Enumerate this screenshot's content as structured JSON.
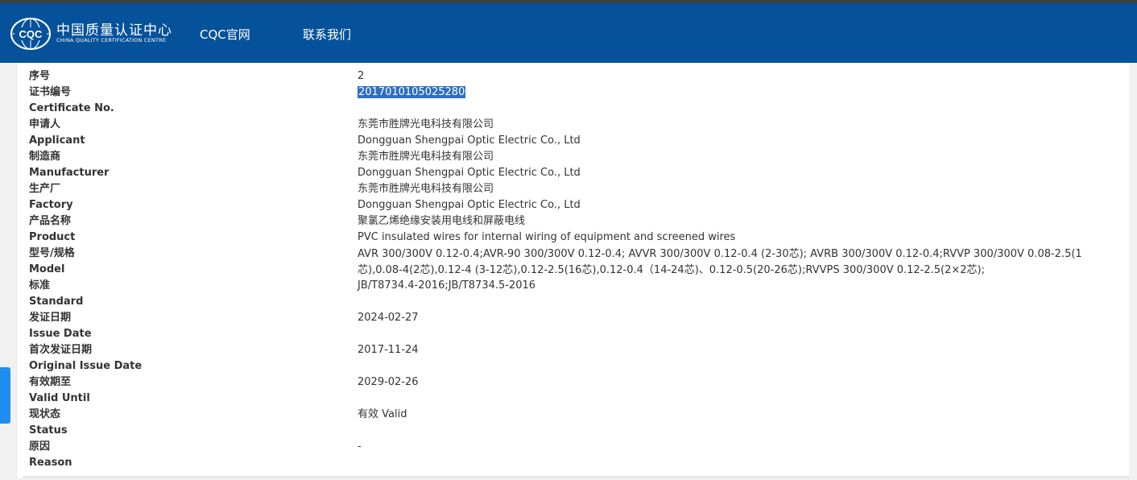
{
  "header": {
    "logo_text_cn": "中国质量认证中心",
    "logo_text_en": "CHINA QUALITY CERTIFICATION CENTRE",
    "logo_mark": "CQC",
    "nav": [
      {
        "label": "CQC官网"
      },
      {
        "label": "联系我们"
      }
    ],
    "bg_color": "#05529a"
  },
  "fields": [
    {
      "label": "序号",
      "value": "2"
    },
    {
      "label": "证书编号",
      "value": "2017010105025280"
    },
    {
      "label": "Certificate No.",
      "value": ""
    },
    {
      "label": "申请人",
      "value": "东莞市胜牌光电科技有限公司"
    },
    {
      "label": "Applicant",
      "value": "Dongguan Shengpai Optic Electric Co., Ltd"
    },
    {
      "label": "制造商",
      "value": "东莞市胜牌光电科技有限公司"
    },
    {
      "label": "Manufacturer",
      "value": "Dongguan Shengpai Optic Electric Co., Ltd"
    },
    {
      "label": "生产厂",
      "value": "东莞市胜牌光电科技有限公司"
    },
    {
      "label": "Factory",
      "value": "Dongguan Shengpai Optic Electric Co., Ltd"
    },
    {
      "label": "产品名称",
      "value": "聚氯乙烯绝缘安装用电线和屏蔽电线"
    },
    {
      "label": "Product",
      "value": "PVC insulated wires for internal wiring of equipment and screened wires"
    },
    {
      "label": "型号/规格",
      "value": "AVR 300/300V 0.12-0.4;AVR-90 300/300V 0.12-0.4; AVVR 300/300V 0.12-0.4 (2-30芯); AVRB 300/300V 0.12-0.4;RVVP 300/300V 0.08-2.5(1芯),0.08-4(2芯),0.12-4 (3-12芯),0.12-2.5(16芯),0.12-0.4（14-24芯)、0.12-0.5(20-26芯);RVVPS 300/300V 0.12-2.5(2×2芯);"
    },
    {
      "label": "Model",
      "value": ""
    },
    {
      "label": "标准",
      "value": "JB/T8734.4-2016;JB/T8734.5-2016"
    },
    {
      "label": "Standard",
      "value": ""
    },
    {
      "label": "发证日期",
      "value": "2024-02-27"
    },
    {
      "label": "Issue Date",
      "value": ""
    },
    {
      "label": "首次发证日期",
      "value": "2017-11-24"
    },
    {
      "label": "Original Issue Date",
      "value": ""
    },
    {
      "label": "有效期至",
      "value": "2029-02-26"
    },
    {
      "label": "Valid Until",
      "value": ""
    },
    {
      "label": "现状态",
      "value": "有效 Valid"
    },
    {
      "label": "Status",
      "value": ""
    },
    {
      "label": "原因",
      "value": "-"
    },
    {
      "label": "Reason",
      "value": ""
    }
  ]
}
